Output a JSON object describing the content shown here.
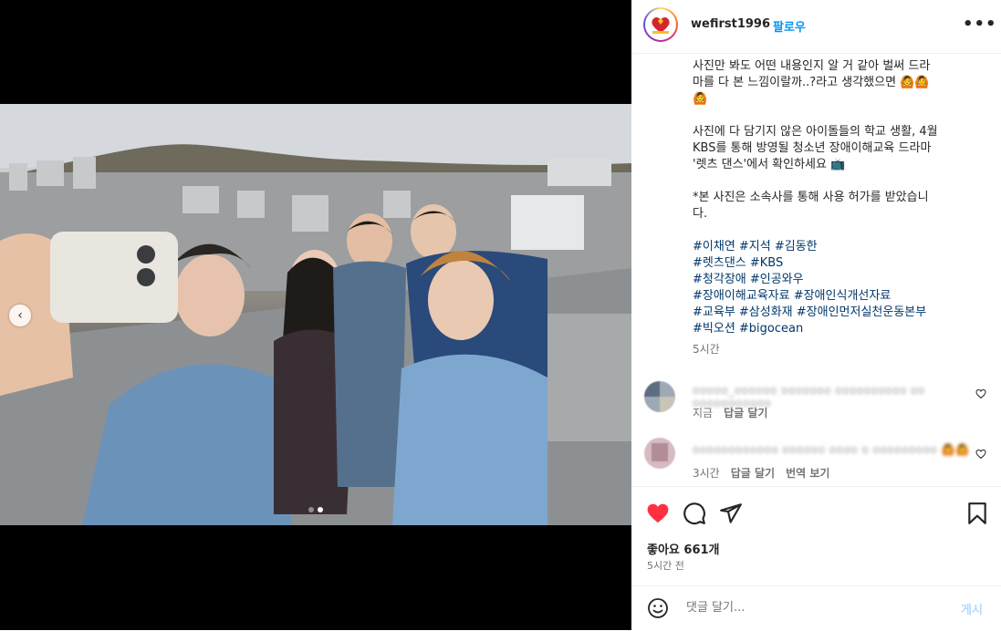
{
  "post": {
    "username": "wefirst1996",
    "separator": "•",
    "follow_label": "팔로우",
    "more_label": "•••",
    "avatar_icon": "brand-logo-icon"
  },
  "caption": {
    "line1": "사진만 봐도 어떤 내용인지 알 거 같아 벌써 드라\n마를 다 본 느낌이랄까..?라고 생각했으면 🙆🙆\n🙆",
    "line2": "사진에 다 담기지 않은 아이돌들의 학교 생활, 4월\nKBS를 통해 방영될 청소년 장애이해교육 드라마\n'렛츠 댄스'에서 확인하세요 📺",
    "line3": "*본 사진은 소속사를 통해 사용 허가를 받았습니\n다.",
    "hashtags": [
      "#이채연 #지석 #김동한",
      "#렛츠댄스 #KBS",
      "#청각장애 #인공와우",
      "#장애이해교육자료 #장애인식개선자료",
      "#교육부 #삼성화재 #장애인먼저실천운동본부",
      "#빅오션 #bigocean"
    ],
    "time": "5시간"
  },
  "comments": [
    {
      "text": "ooooo_oooooo ooooooo oooooooooo oo ooooooooooo",
      "time": "지금",
      "reply": "답글 달기",
      "translate": ""
    },
    {
      "text": "oooooooooooo oooooo oooo o ooooooooo 🙆🙆",
      "time": "3시간",
      "reply": "답글 달기",
      "translate": "번역 보기"
    }
  ],
  "actions": {
    "likes": "좋아요 661개",
    "posted": "5시간 전",
    "like_color": "#ff3040"
  },
  "comment_bar": {
    "placeholder": "댓글 달기...",
    "post_label": "게시"
  },
  "carousel": {
    "prev_arrow": "‹",
    "total": 2,
    "active": 2
  }
}
